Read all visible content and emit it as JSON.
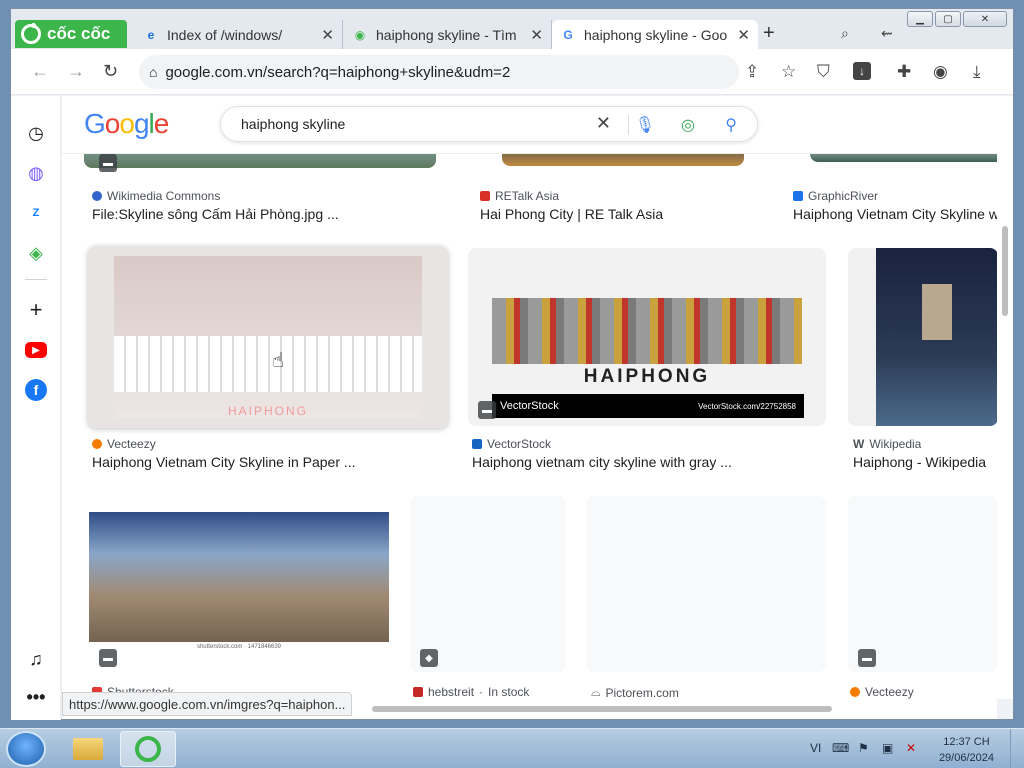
{
  "browser": {
    "brand": "cốc cốc",
    "tabs": [
      {
        "title": "Index of /windows/",
        "favicon": "ie-icon"
      },
      {
        "title": "haiphong skyline - Tìm",
        "favicon": "coccoc-icon"
      },
      {
        "title": "haiphong skyline - Goo",
        "favicon": "google-icon",
        "active": true
      }
    ],
    "new_tab": "+",
    "address": "google.com.vn/search?q=haiphong+skyline&udm=2",
    "status_url": "https://www.google.com.vn/imgres?q=haiphon..."
  },
  "google": {
    "logo": "Google",
    "query": "haiphong skyline"
  },
  "results": {
    "row0": [
      {
        "source": "Wikimedia Commons",
        "title": "File:Skyline sông Cấm Hải Phòng.jpg ...",
        "color": "#3366cc"
      },
      {
        "source": "RETalk Asia",
        "title": "Hai Phong City | RE Talk Asia",
        "color": "#d93025"
      },
      {
        "source": "GraphicRiver",
        "title": "Haiphong Vietnam City Skyline wi",
        "color": "#1a73e8"
      }
    ],
    "row1": [
      {
        "source": "Vecteezy",
        "title": "Haiphong Vietnam City Skyline in Paper ...",
        "color": "#f57c00",
        "image_text": "HAIPHONG"
      },
      {
        "source": "VectorStock",
        "title": "Haiphong vietnam city skyline with gray ...",
        "color": "#1565c0",
        "image_text": "HAIPHONG",
        "watermark": "VectorStock",
        "watermark_url": "VectorStock.com/22752858"
      },
      {
        "source": "Wikipedia",
        "title": "Haiphong - Wikipedia",
        "color": "#444444"
      }
    ],
    "row2": [
      {
        "source": "Shutterstock",
        "color": "#e53935",
        "caption": "shutterstock.com · 1471846639"
      },
      {
        "source": "hebstreit",
        "stock": "In stock",
        "color": "#c62828"
      },
      {
        "source": "Pictorem.com",
        "color": "#555555"
      },
      {
        "source": "Vecteezy",
        "color": "#f57c00"
      }
    ]
  },
  "taskbar": {
    "lang": "VI",
    "time": "12:37 CH",
    "date": "29/06/2024"
  }
}
